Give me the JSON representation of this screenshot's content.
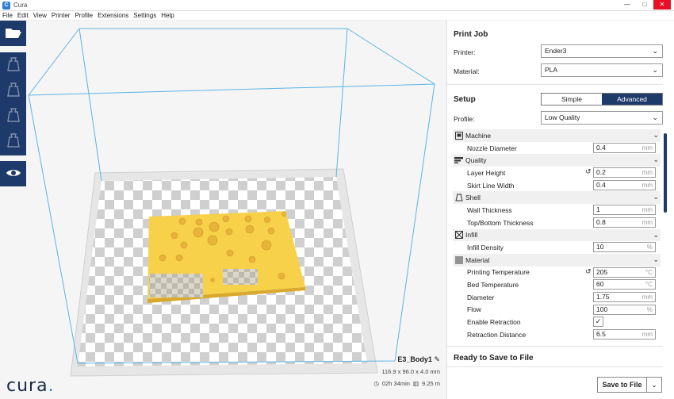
{
  "window": {
    "title": "Cura",
    "app_icon": "C"
  },
  "menu": [
    "File",
    "Edit",
    "View",
    "Printer",
    "Profile",
    "Extensions",
    "Settings",
    "Help"
  ],
  "toolbar": {
    "tools": [
      "open-file-icon",
      "move-tool-icon",
      "scale-tool-icon",
      "rotate-tool-icon",
      "mirror-tool-icon",
      "view-mode-icon"
    ]
  },
  "object": {
    "name": "E3_Body1",
    "dimensions": "116.9 x 96.0 x 4.0 mm",
    "print_time": "02h 34min",
    "filament": "9.25 m"
  },
  "brand": {
    "logo_text": "cura",
    "logo_dot": "."
  },
  "print_job": {
    "title": "Print Job",
    "printer_label": "Printer:",
    "printer_value": "Ender3",
    "material_label": "Material:",
    "material_value": "PLA"
  },
  "setup": {
    "title": "Setup",
    "mode_simple": "Simple",
    "mode_advanced": "Advanced",
    "profile_label": "Profile:",
    "profile_value": "Low Quality"
  },
  "categories": {
    "machine": "Machine",
    "quality": "Quality",
    "shell": "Shell",
    "infill": "Infill",
    "material": "Material"
  },
  "settings": {
    "nozzle_diameter": {
      "label": "Nozzle Diameter",
      "value": "0.4",
      "unit": "mm"
    },
    "layer_height": {
      "label": "Layer Height",
      "value": "0.2",
      "unit": "mm"
    },
    "skirt_line_width": {
      "label": "Skirt Line Width",
      "value": "0.4",
      "unit": "mm"
    },
    "wall_thickness": {
      "label": "Wall Thickness",
      "value": "1",
      "unit": "mm"
    },
    "top_bottom_thickness": {
      "label": "Top/Bottom Thickness",
      "value": "0.8",
      "unit": "mm"
    },
    "infill_density": {
      "label": "Infill Density",
      "value": "10",
      "unit": "%"
    },
    "printing_temperature": {
      "label": "Printing Temperature",
      "value": "205",
      "unit": "°C"
    },
    "bed_temperature": {
      "label": "Bed Temperature",
      "value": "60",
      "unit": "°C"
    },
    "diameter": {
      "label": "Diameter",
      "value": "1.75",
      "unit": "mm"
    },
    "flow": {
      "label": "Flow",
      "value": "100",
      "unit": "%"
    },
    "enable_retraction": {
      "label": "Enable Retraction",
      "checked": true,
      "check_glyph": "✓"
    },
    "retraction_distance": {
      "label": "Retraction Distance",
      "value": "6.5",
      "unit": "mm"
    }
  },
  "footer": {
    "status": "Ready to Save to File",
    "save_button": "Save to File"
  },
  "colors": {
    "accent": "#1d3a6b",
    "model": "#f7d14a",
    "build_volume": "#5bb4e6"
  }
}
